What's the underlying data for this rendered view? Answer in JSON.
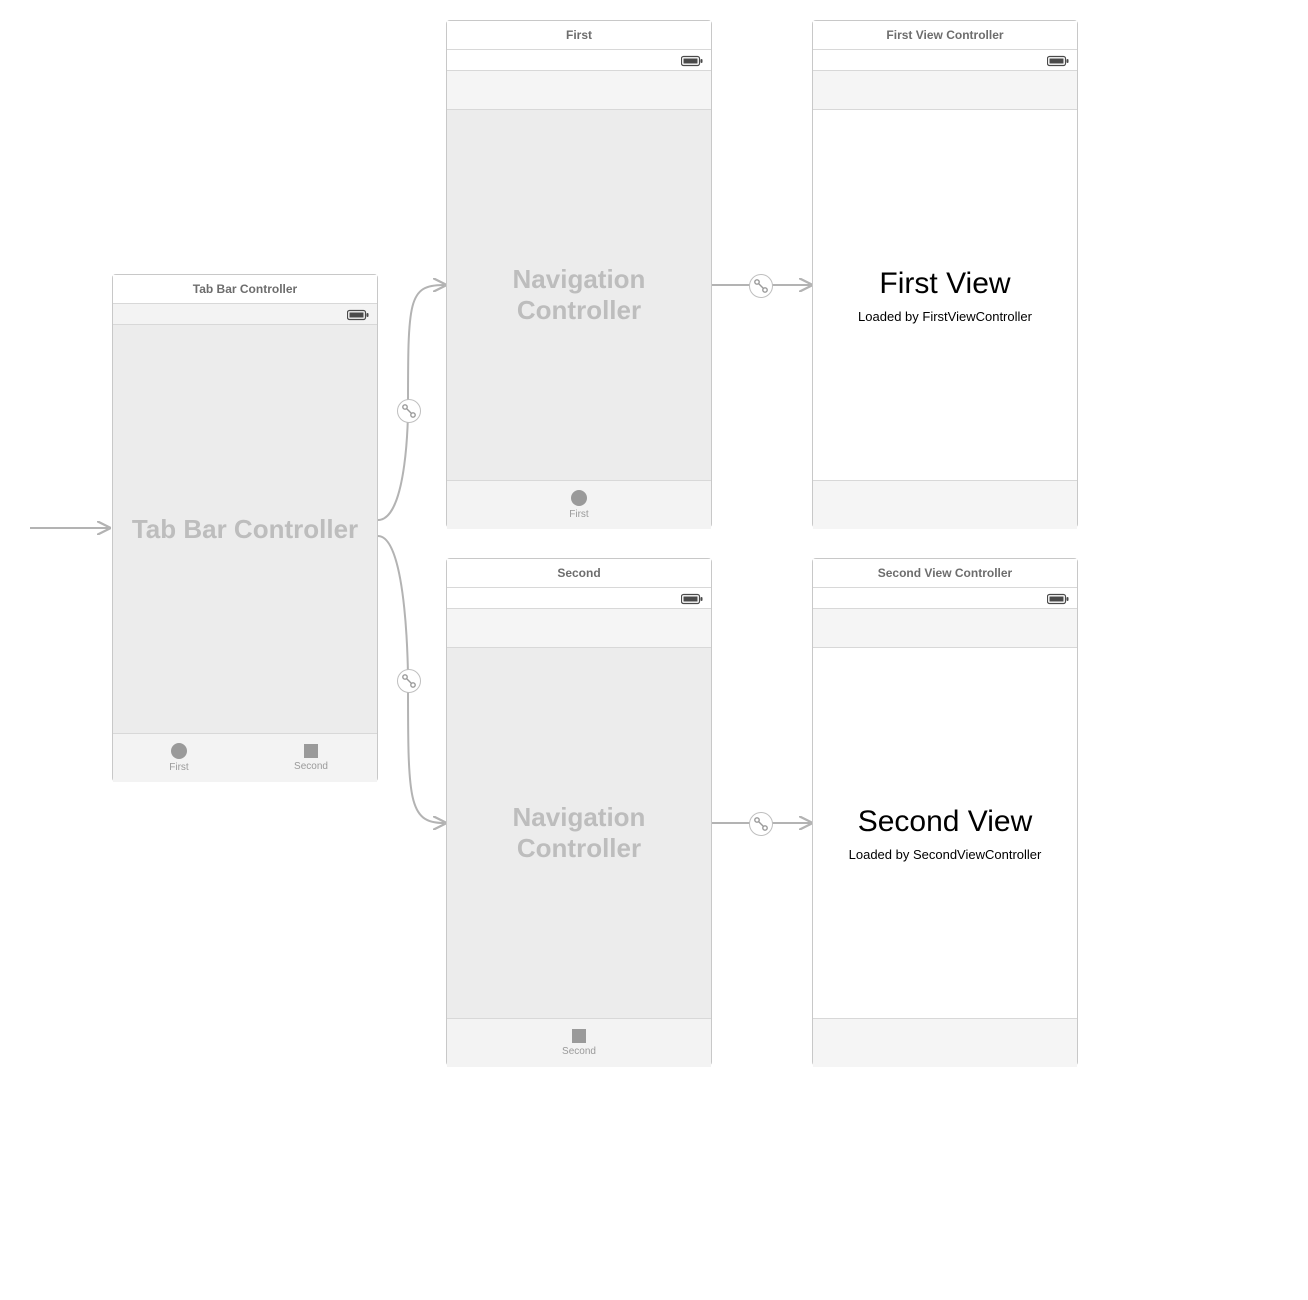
{
  "scenes": {
    "tabbar": {
      "title": "Tab Bar Controller",
      "bodyLabel": "Tab Bar Controller",
      "tabs": [
        {
          "label": "First",
          "icon": "circle"
        },
        {
          "label": "Second",
          "icon": "square"
        }
      ]
    },
    "nav1": {
      "title": "First",
      "bodyLabel": "Navigation Controller",
      "tab": {
        "label": "First",
        "icon": "circle"
      }
    },
    "nav2": {
      "title": "Second",
      "bodyLabel": "Navigation Controller",
      "tab": {
        "label": "Second",
        "icon": "square"
      }
    },
    "vc1": {
      "title": "First View Controller",
      "viewTitle": "First View",
      "viewSubtitle": "Loaded by FirstViewController"
    },
    "vc2": {
      "title": "Second View Controller",
      "viewTitle": "Second View",
      "viewSubtitle": "Loaded by SecondViewController"
    }
  }
}
